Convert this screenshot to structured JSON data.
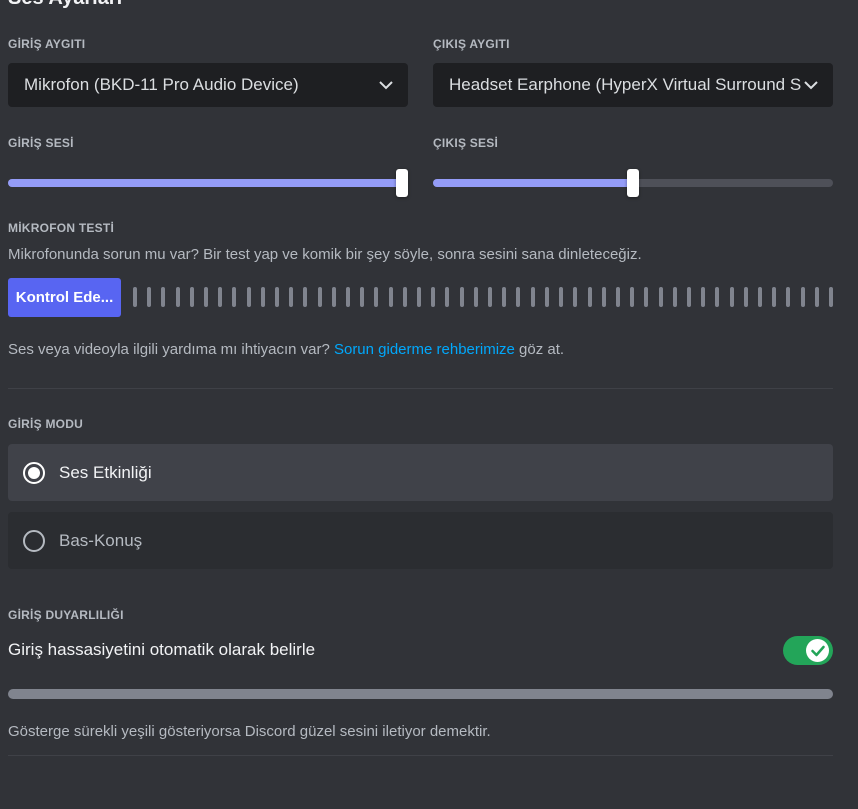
{
  "page_title": "Ses Ayarları",
  "input_device": {
    "label": "GİRİŞ AYGITI",
    "value": "Mikrofon (BKD-11 Pro Audio Device)"
  },
  "output_device": {
    "label": "ÇIKIŞ AYGITI",
    "value": "Headset Earphone (HyperX Virtual Surround Sound)"
  },
  "input_volume": {
    "label": "GİRİŞ SESİ",
    "level_percent": 100
  },
  "output_volume": {
    "label": "ÇIKIŞ SESİ",
    "level_percent": 50
  },
  "mic_test": {
    "label": "MİKROFON TESTİ",
    "description": "Mikrofonunda sorun mu var? Bir test yap ve komik bir şey söyle, sonra sesini sana dinleteceğiz.",
    "button_label": "Kontrol Ede...",
    "meter_level_percent": 0
  },
  "help": {
    "prefix": "Ses veya videoyla ilgili yardıma mı ihtiyacın var? ",
    "link": "Sorun giderme rehberimize",
    "suffix": " göz at."
  },
  "input_mode": {
    "label": "GİRİŞ MODU",
    "options": [
      {
        "label": "Ses Etkinliği",
        "selected": true
      },
      {
        "label": "Bas-Konuş",
        "selected": false
      }
    ]
  },
  "input_sensitivity": {
    "label": "GİRİŞ DUYARLILIĞI",
    "auto_label": "Giriş hassasiyetini otomatik olarak belirle",
    "auto_enabled": true,
    "footer": "Gösterge sürekli yeşili gösteriyorsa Discord güzel sesini iletiyor demektir."
  },
  "colors": {
    "accent": "#5865f2",
    "slider_fill": "#949cf7",
    "toggle_on": "#23a559",
    "link": "#00a8fc"
  },
  "icons": [
    "chevron-down-icon",
    "checkmark-icon"
  ]
}
